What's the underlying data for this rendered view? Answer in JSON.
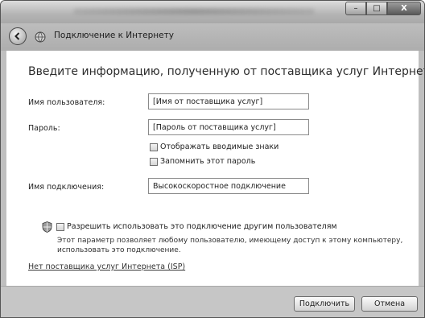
{
  "window": {
    "title": ""
  },
  "caption_buttons": {
    "minimize": "–",
    "maximize": "□",
    "close": "X"
  },
  "nav": {
    "title": "Подключение к Интернету"
  },
  "form": {
    "heading": "Введите информацию, полученную от поставщика услуг Интернета",
    "username": {
      "label": "Имя пользователя:",
      "value": "[Имя от поставщика услуг]"
    },
    "password": {
      "label": "Пароль:",
      "value": "[Пароль от поставщика услуг]"
    },
    "show_chars": {
      "label": "Отображать вводимые знаки",
      "checked": false
    },
    "remember": {
      "label": "Запомнить этот пароль",
      "checked": false
    },
    "connection_name": {
      "label": "Имя подключения:",
      "value": "Высокоскоростное подключение"
    },
    "allow_others": {
      "label": "Разрешить использовать это подключение другим пользователям",
      "checked": false,
      "note": "Этот параметр позволяет любому пользователю, имеющему доступ к этому компьютеру, использовать это подключение."
    },
    "no_isp_link": "Нет поставщика услуг Интернета (ISP)"
  },
  "footer": {
    "connect_label": "Подключить",
    "cancel_label": "Отмена"
  }
}
